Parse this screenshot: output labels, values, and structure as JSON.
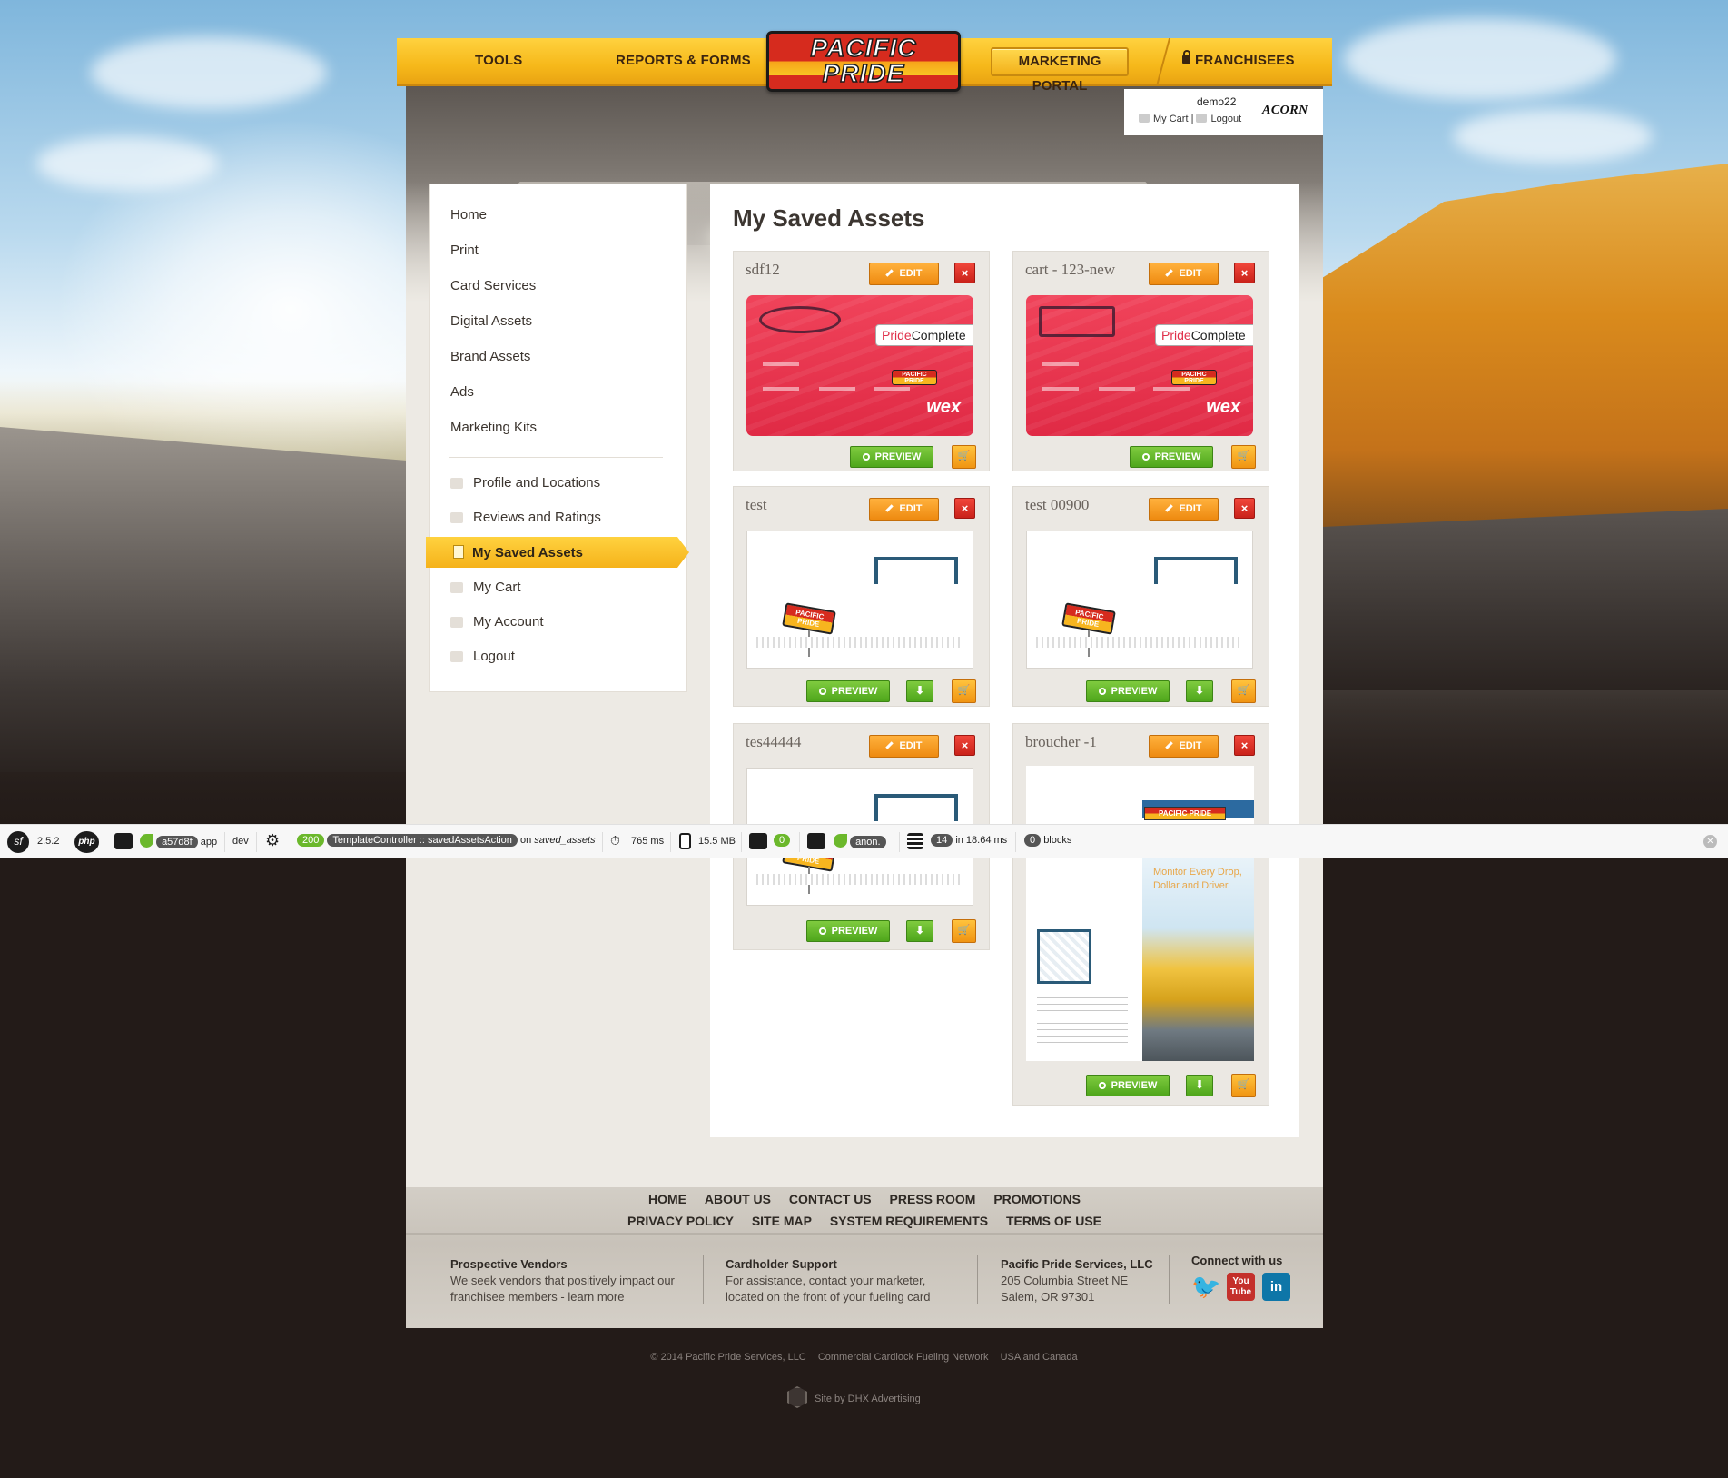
{
  "nav": {
    "tools": "TOOLS",
    "reports_forms": "REPORTS & FORMS",
    "logo_line1": "PACIFIC",
    "logo_line2": "PRIDE",
    "marketing_portal": "MARKETING PORTAL",
    "franchisees": "FRANCHISEES"
  },
  "user": {
    "name": "demo22",
    "cart_label": "My Cart",
    "separator": "|",
    "logout_label": "Logout",
    "partner_logo": "ACORN"
  },
  "sidebar": {
    "items": [
      {
        "label": "Home"
      },
      {
        "label": "Print"
      },
      {
        "label": "Card Services"
      },
      {
        "label": "Digital Assets"
      },
      {
        "label": "Brand Assets"
      },
      {
        "label": "Ads"
      },
      {
        "label": "Marketing Kits"
      }
    ],
    "account_items": [
      {
        "label": "Profile and Locations",
        "icon": "briefcase-icon"
      },
      {
        "label": "Reviews and Ratings",
        "icon": "speech-bubble-icon"
      },
      {
        "label": "My Saved Assets",
        "icon": "document-icon",
        "active": true
      },
      {
        "label": "My Cart",
        "icon": "cart-icon"
      },
      {
        "label": "My Account",
        "icon": "briefcase-icon"
      },
      {
        "label": "Logout",
        "icon": "lock-icon"
      }
    ]
  },
  "main": {
    "title": "My Saved Assets",
    "edit_label": "EDIT",
    "delete_label": "×",
    "preview_label": "PREVIEW",
    "assets": [
      {
        "title": "sdf12"
      },
      {
        "title": "cart - 123-new"
      },
      {
        "title": "test"
      },
      {
        "title": "test 00900"
      },
      {
        "title": "tes44444"
      },
      {
        "title": "broucher -1"
      }
    ],
    "card_badge_prefix": "Pride",
    "card_badge_suffix": "Complete",
    "card_brand": "wex",
    "mini_logo": "PACIFIC PRIDE",
    "brochure_text": "Monitor Every Drop, Dollar and Driver."
  },
  "debug": {
    "symfony_version": "2.5.2",
    "php_label": "php",
    "token": "a57d8f",
    "app_label": "app",
    "env": "dev",
    "status": "200",
    "controller": "TemplateController :: savedAssetsAction",
    "route_prefix": "on",
    "route": "saved_assets",
    "time": "765 ms",
    "memory": "15.5 MB",
    "forms_count": "0",
    "user": "anon.",
    "queries": "14",
    "query_time": "in 18.64 ms",
    "blocks_count": "0",
    "blocks_label": "blocks"
  },
  "footer": {
    "links_row1": [
      "HOME",
      "ABOUT US",
      "CONTACT US",
      "PRESS ROOM",
      "PROMOTIONS"
    ],
    "links_row2": [
      "PRIVACY POLICY",
      "SITE MAP",
      "SYSTEM REQUIREMENTS",
      "TERMS OF USE"
    ],
    "col1_title": "Prospective Vendors",
    "col1_text1": "We seek vendors that positively impact our",
    "col1_text2": "franchisee members - learn more",
    "col2_title": "Cardholder Support",
    "col2_text1": "For assistance, contact your marketer,",
    "col2_text2": "located on the front of your fueling card",
    "col3_title": "Pacific Pride Services, LLC",
    "col3_text1": "205 Columbia Street NE",
    "col3_text2": "Salem, OR 97301",
    "social_title": "Connect with us",
    "copyright": "© 2014 Pacific Pride Services, LLC",
    "network": "Commercial Cardlock Fueling Network",
    "region": "USA and Canada",
    "site_by": "Site by DHX Advertising"
  },
  "colors": {
    "brand_yellow": "#f6b81a",
    "brand_red": "#d62b1e",
    "edit_orange": "#ee8a10",
    "preview_green": "#4ea61b"
  }
}
